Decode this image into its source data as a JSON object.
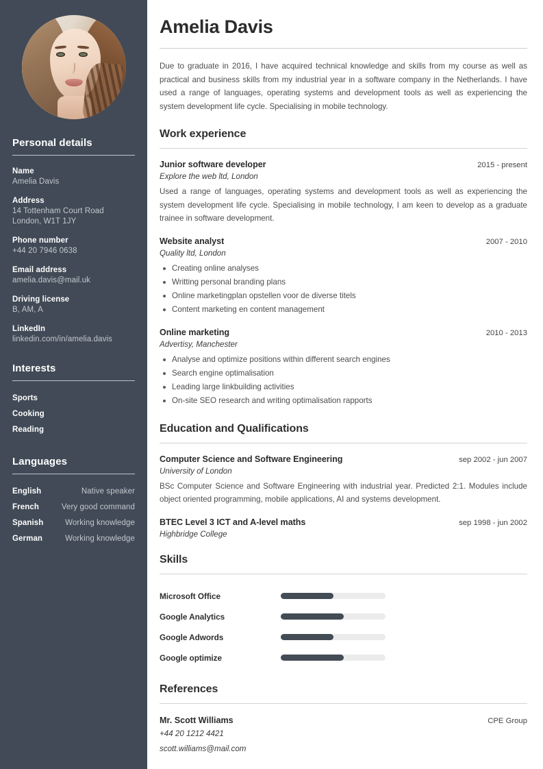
{
  "sidebar": {
    "avatar_alt": "profile-photo",
    "personal_details": {
      "heading": "Personal details",
      "items": [
        {
          "label": "Name",
          "value": "Amelia Davis"
        },
        {
          "label": "Address",
          "value": "14 Tottenham Court Road\nLondon, W1T 1JY"
        },
        {
          "label": "Phone number",
          "value": "+44 20 7946 0638"
        },
        {
          "label": "Email address",
          "value": "amelia.davis@mail.uk"
        },
        {
          "label": "Driving license",
          "value": "B, AM, A"
        },
        {
          "label": "LinkedIn",
          "value": "linkedin.com/in/amelia.davis"
        }
      ]
    },
    "interests": {
      "heading": "Interests",
      "items": [
        "Sports",
        "Cooking",
        "Reading"
      ]
    },
    "languages": {
      "heading": "Languages",
      "items": [
        {
          "name": "English",
          "level": "Native speaker"
        },
        {
          "name": "French",
          "level": "Very good command"
        },
        {
          "name": "Spanish",
          "level": "Working knowledge"
        },
        {
          "name": "German",
          "level": "Working knowledge"
        }
      ]
    }
  },
  "main": {
    "name": "Amelia Davis",
    "summary": "Due to graduate in 2016, I have acquired technical knowledge and skills from my course as well as practical and business skills from my industrial year in a software company in the Netherlands. I have used a range of languages, operating systems and development tools as well as experiencing the system development life cycle. Specialising in mobile technology.",
    "work_experience": {
      "heading": "Work experience",
      "entries": [
        {
          "title": "Junior software developer",
          "date": "2015 - present",
          "subtitle": "Explore the web ltd, London",
          "description": "Used a range of languages, operating systems and development tools as well as experiencing the system development life cycle. Specialising in mobile technology, I am keen to develop as a graduate trainee in software development.",
          "bullets": []
        },
        {
          "title": "Website analyst",
          "date": "2007 - 2010",
          "subtitle": "Quality ltd, London",
          "description": "",
          "bullets": [
            "Creating online analyses",
            "Writting personal branding plans",
            "Online marketingplan opstellen voor de diverse titels",
            "Content marketing en content management"
          ]
        },
        {
          "title": "Online marketing",
          "date": "2010 - 2013",
          "subtitle": "Advertisy, Manchester",
          "description": "",
          "bullets": [
            "Analyse and optimize positions within different search engines",
            "Search engine optimalisation",
            "Leading large linkbuilding activities",
            "On-site SEO research and writing optimalisation rapports"
          ]
        }
      ]
    },
    "education": {
      "heading": "Education and Qualifications",
      "entries": [
        {
          "title": "Computer Science and Software Engineering",
          "date": "sep 2002 - jun 2007",
          "subtitle": "University of London",
          "description": "BSc Computer Science and Software Engineering with industrial year. Predicted 2:1. Modules include object oriented programming, mobile applications, AI and systems development."
        },
        {
          "title": "BTEC Level 3 ICT and A-level maths",
          "date": "sep 1998 - jun 2002",
          "subtitle": "Highbridge College",
          "description": ""
        }
      ]
    },
    "skills": {
      "heading": "Skills",
      "items": [
        {
          "name": "Microsoft Office",
          "percent": 50
        },
        {
          "name": "Google Analytics",
          "percent": 60
        },
        {
          "name": "Google Adwords",
          "percent": 50
        },
        {
          "name": "Google optimize",
          "percent": 60
        }
      ]
    },
    "references": {
      "heading": "References",
      "entries": [
        {
          "name": "Mr. Scott Williams",
          "organisation": "CPE Group",
          "phone": "+44 20 1212 4421",
          "email": "scott.williams@mail.com"
        }
      ]
    }
  },
  "colors": {
    "sidebar_bg": "#414a56",
    "skill_fill": "#434b55",
    "skill_track": "#ebebeb",
    "text_dark": "#2b2b2b",
    "text_body": "#4c4c4c",
    "sidebar_value": "#c3c8ce"
  }
}
